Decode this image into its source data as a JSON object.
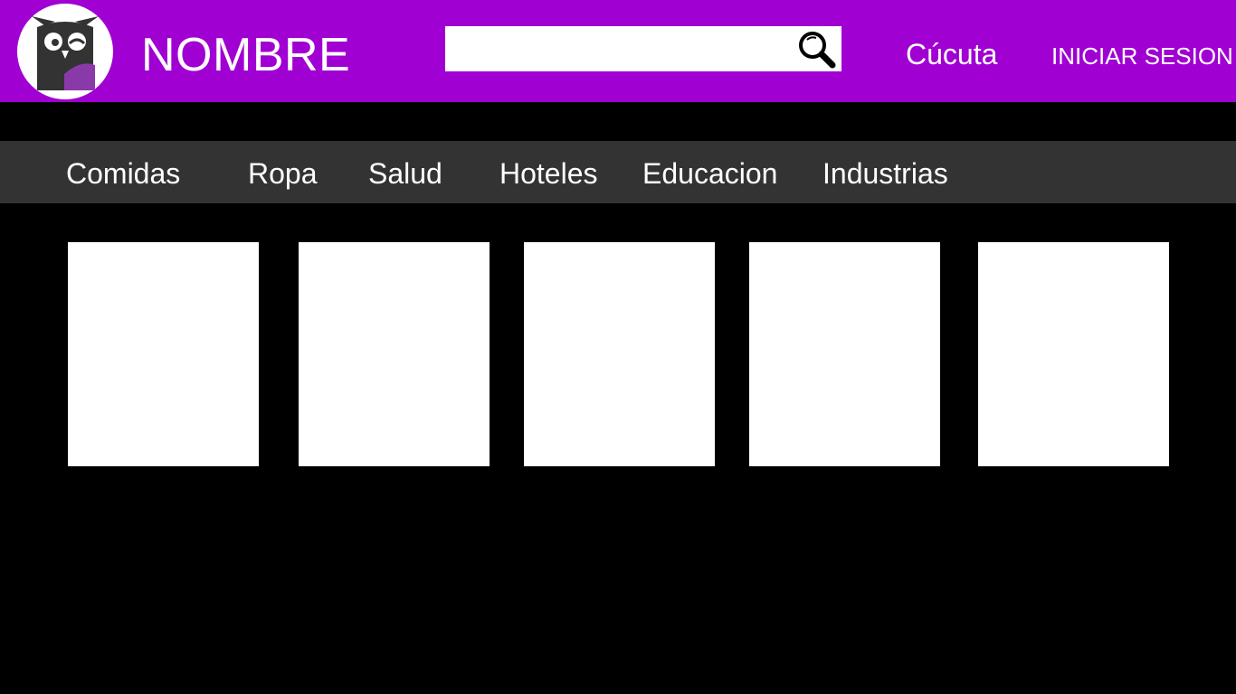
{
  "header": {
    "brand": "NOMBRE",
    "search": {
      "value": "",
      "placeholder": ""
    },
    "city": "Cúcuta",
    "login": "INICIAR SESION",
    "logo_icon": "owl-logo-icon",
    "search_icon": "magnifier-icon"
  },
  "categories": [
    "Comidas",
    "Ropa",
    "Salud",
    "Hoteles",
    "Educacion",
    "Industrias"
  ],
  "cards": [
    {},
    {},
    {},
    {},
    {}
  ],
  "colors": {
    "header_bg": "#a000d2",
    "page_bg": "#000000",
    "catbar_bg": "#333333",
    "card_bg": "#ffffff",
    "owl_purple": "#8a3aa8"
  }
}
